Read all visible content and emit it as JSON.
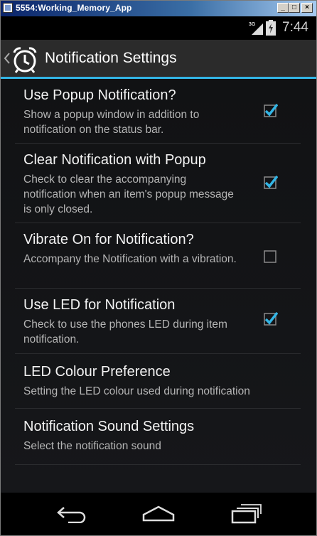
{
  "window": {
    "title": "5554:Working_Memory_App",
    "min_label": "_",
    "max_label": "□",
    "close_label": "×"
  },
  "status_bar": {
    "network": "3G",
    "time": "7:44"
  },
  "action_bar": {
    "title": "Notification Settings",
    "accent_color": "#33b5e5"
  },
  "preferences": [
    {
      "title": "Use Popup Notification?",
      "summary": "Show a popup window in addition to notification on the status bar.",
      "checked": true
    },
    {
      "title": "Clear Notification with Popup",
      "summary": "Check to clear the accompanying notification when an item's popup message is only closed.",
      "checked": true
    },
    {
      "title": "Vibrate On for Notification?",
      "summary": "Accompany the Notification with a vibration.",
      "checked": false
    },
    {
      "title": "Use LED for Notification",
      "summary": "Check to use the phones LED during item notification.",
      "checked": true
    },
    {
      "title": "LED Colour Preference",
      "summary": "Setting the LED colour used during notification"
    },
    {
      "title": "Notification Sound Settings",
      "summary": "Select the notification sound"
    }
  ],
  "nav_bar": {
    "icons": [
      "back-icon",
      "home-icon",
      "recent-apps-icon"
    ]
  }
}
